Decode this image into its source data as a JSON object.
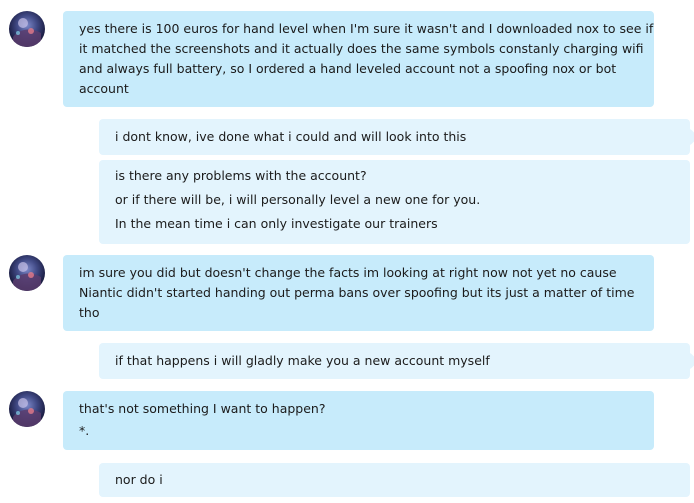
{
  "messages": [
    {
      "direction": "incoming",
      "lines": [
        "yes there is 100 euros for hand level when I'm sure it wasn't and I downloaded nox to see if",
        "it matched the screenshots and it actually does the same symbols constanly charging wifi",
        "and always full battery, so I ordered a hand leveled account not a spoofing nox or bot",
        "account"
      ]
    },
    {
      "direction": "outgoing",
      "lines": [
        "i dont know, ive done what i could and will look into this"
      ]
    },
    {
      "direction": "outgoing",
      "lines": [
        "is there any problems with the account?",
        "or if there will be, i will personally level a new one for you.",
        "In the mean time i can only investigate our trainers"
      ]
    },
    {
      "direction": "incoming",
      "lines": [
        "im sure you did but doesn't change the facts im looking at right now not yet no cause",
        "Niantic didn't started handing out perma bans over spoofing but its just a matter of time",
        "tho"
      ]
    },
    {
      "direction": "outgoing",
      "lines": [
        "if that happens i will gladly make you a new account myself"
      ]
    },
    {
      "direction": "incoming",
      "lines": [
        "that's not something I want to happen?",
        "*."
      ]
    },
    {
      "direction": "outgoing",
      "lines": [
        "nor do i"
      ]
    }
  ],
  "colors": {
    "incoming_bubble": "#c7ebfb",
    "outgoing_bubble": "#e3f4fd",
    "text": "#1b1b1b"
  },
  "icons": {
    "avatar": "user-avatar"
  }
}
